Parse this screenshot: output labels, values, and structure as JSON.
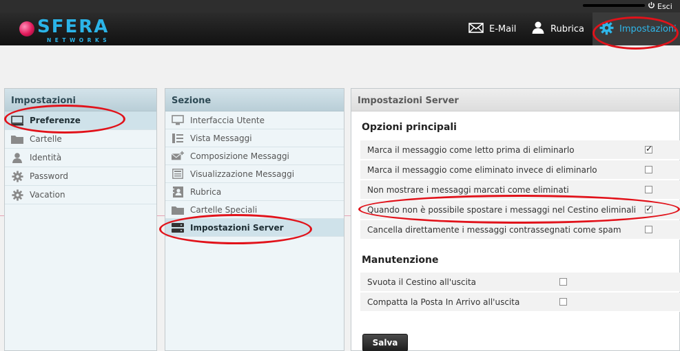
{
  "topbar": {
    "logout_label": "Esci"
  },
  "brand": {
    "name": "SFERA",
    "tagline": "NETWORKS"
  },
  "nav": {
    "mail_label": "E-Mail",
    "contacts_label": "Rubrica",
    "settings_label": "Impostazioni"
  },
  "colors": {
    "accent": "#2fb7ea",
    "annotation": "#e1121a",
    "header": "#1a1a1a",
    "panel_header": "#c5d8e0"
  },
  "settings_panel": {
    "title": "Impostazioni",
    "items": [
      {
        "label": "Preferenze",
        "icon": "monitor-icon",
        "selected": true
      },
      {
        "label": "Cartelle",
        "icon": "folder-icon"
      },
      {
        "label": "Identità",
        "icon": "person-icon"
      },
      {
        "label": "Password",
        "icon": "gear-icon"
      },
      {
        "label": "Vacation",
        "icon": "gear-icon"
      }
    ]
  },
  "section_panel": {
    "title": "Sezione",
    "items": [
      {
        "label": "Interfaccia Utente",
        "icon": "monitor-icon"
      },
      {
        "label": "Vista Messaggi",
        "icon": "list-view-icon"
      },
      {
        "label": "Composizione Messaggi",
        "icon": "compose-icon"
      },
      {
        "label": "Visualizzazione Messaggi",
        "icon": "message-view-icon"
      },
      {
        "label": "Rubrica",
        "icon": "address-book-icon"
      },
      {
        "label": "Cartelle Speciali",
        "icon": "folder-icon"
      },
      {
        "label": "Impostazioni Server",
        "icon": "server-icon",
        "selected": true
      }
    ]
  },
  "server_panel": {
    "title": "Impostazioni Server",
    "main_section": {
      "title": "Opzioni principali",
      "options": [
        {
          "label": "Marca il messaggio come letto prima di eliminarlo",
          "checked": true
        },
        {
          "label": "Marca il messaggio come eliminato invece di eliminarlo",
          "checked": false
        },
        {
          "label": "Non mostrare i messaggi marcati come eliminati",
          "checked": false
        },
        {
          "label": "Quando non è possibile spostare i messaggi nel Cestino eliminali",
          "checked": true
        },
        {
          "label": "Cancella direttamente i messaggi contrassegnati come spam",
          "checked": false
        }
      ]
    },
    "maintenance_section": {
      "title": "Manutenzione",
      "options": [
        {
          "label": "Svuota il Cestino all'uscita",
          "checked": false
        },
        {
          "label": "Compatta la Posta In Arrivo all'uscita",
          "checked": false
        }
      ]
    },
    "save_label": "Salva"
  }
}
